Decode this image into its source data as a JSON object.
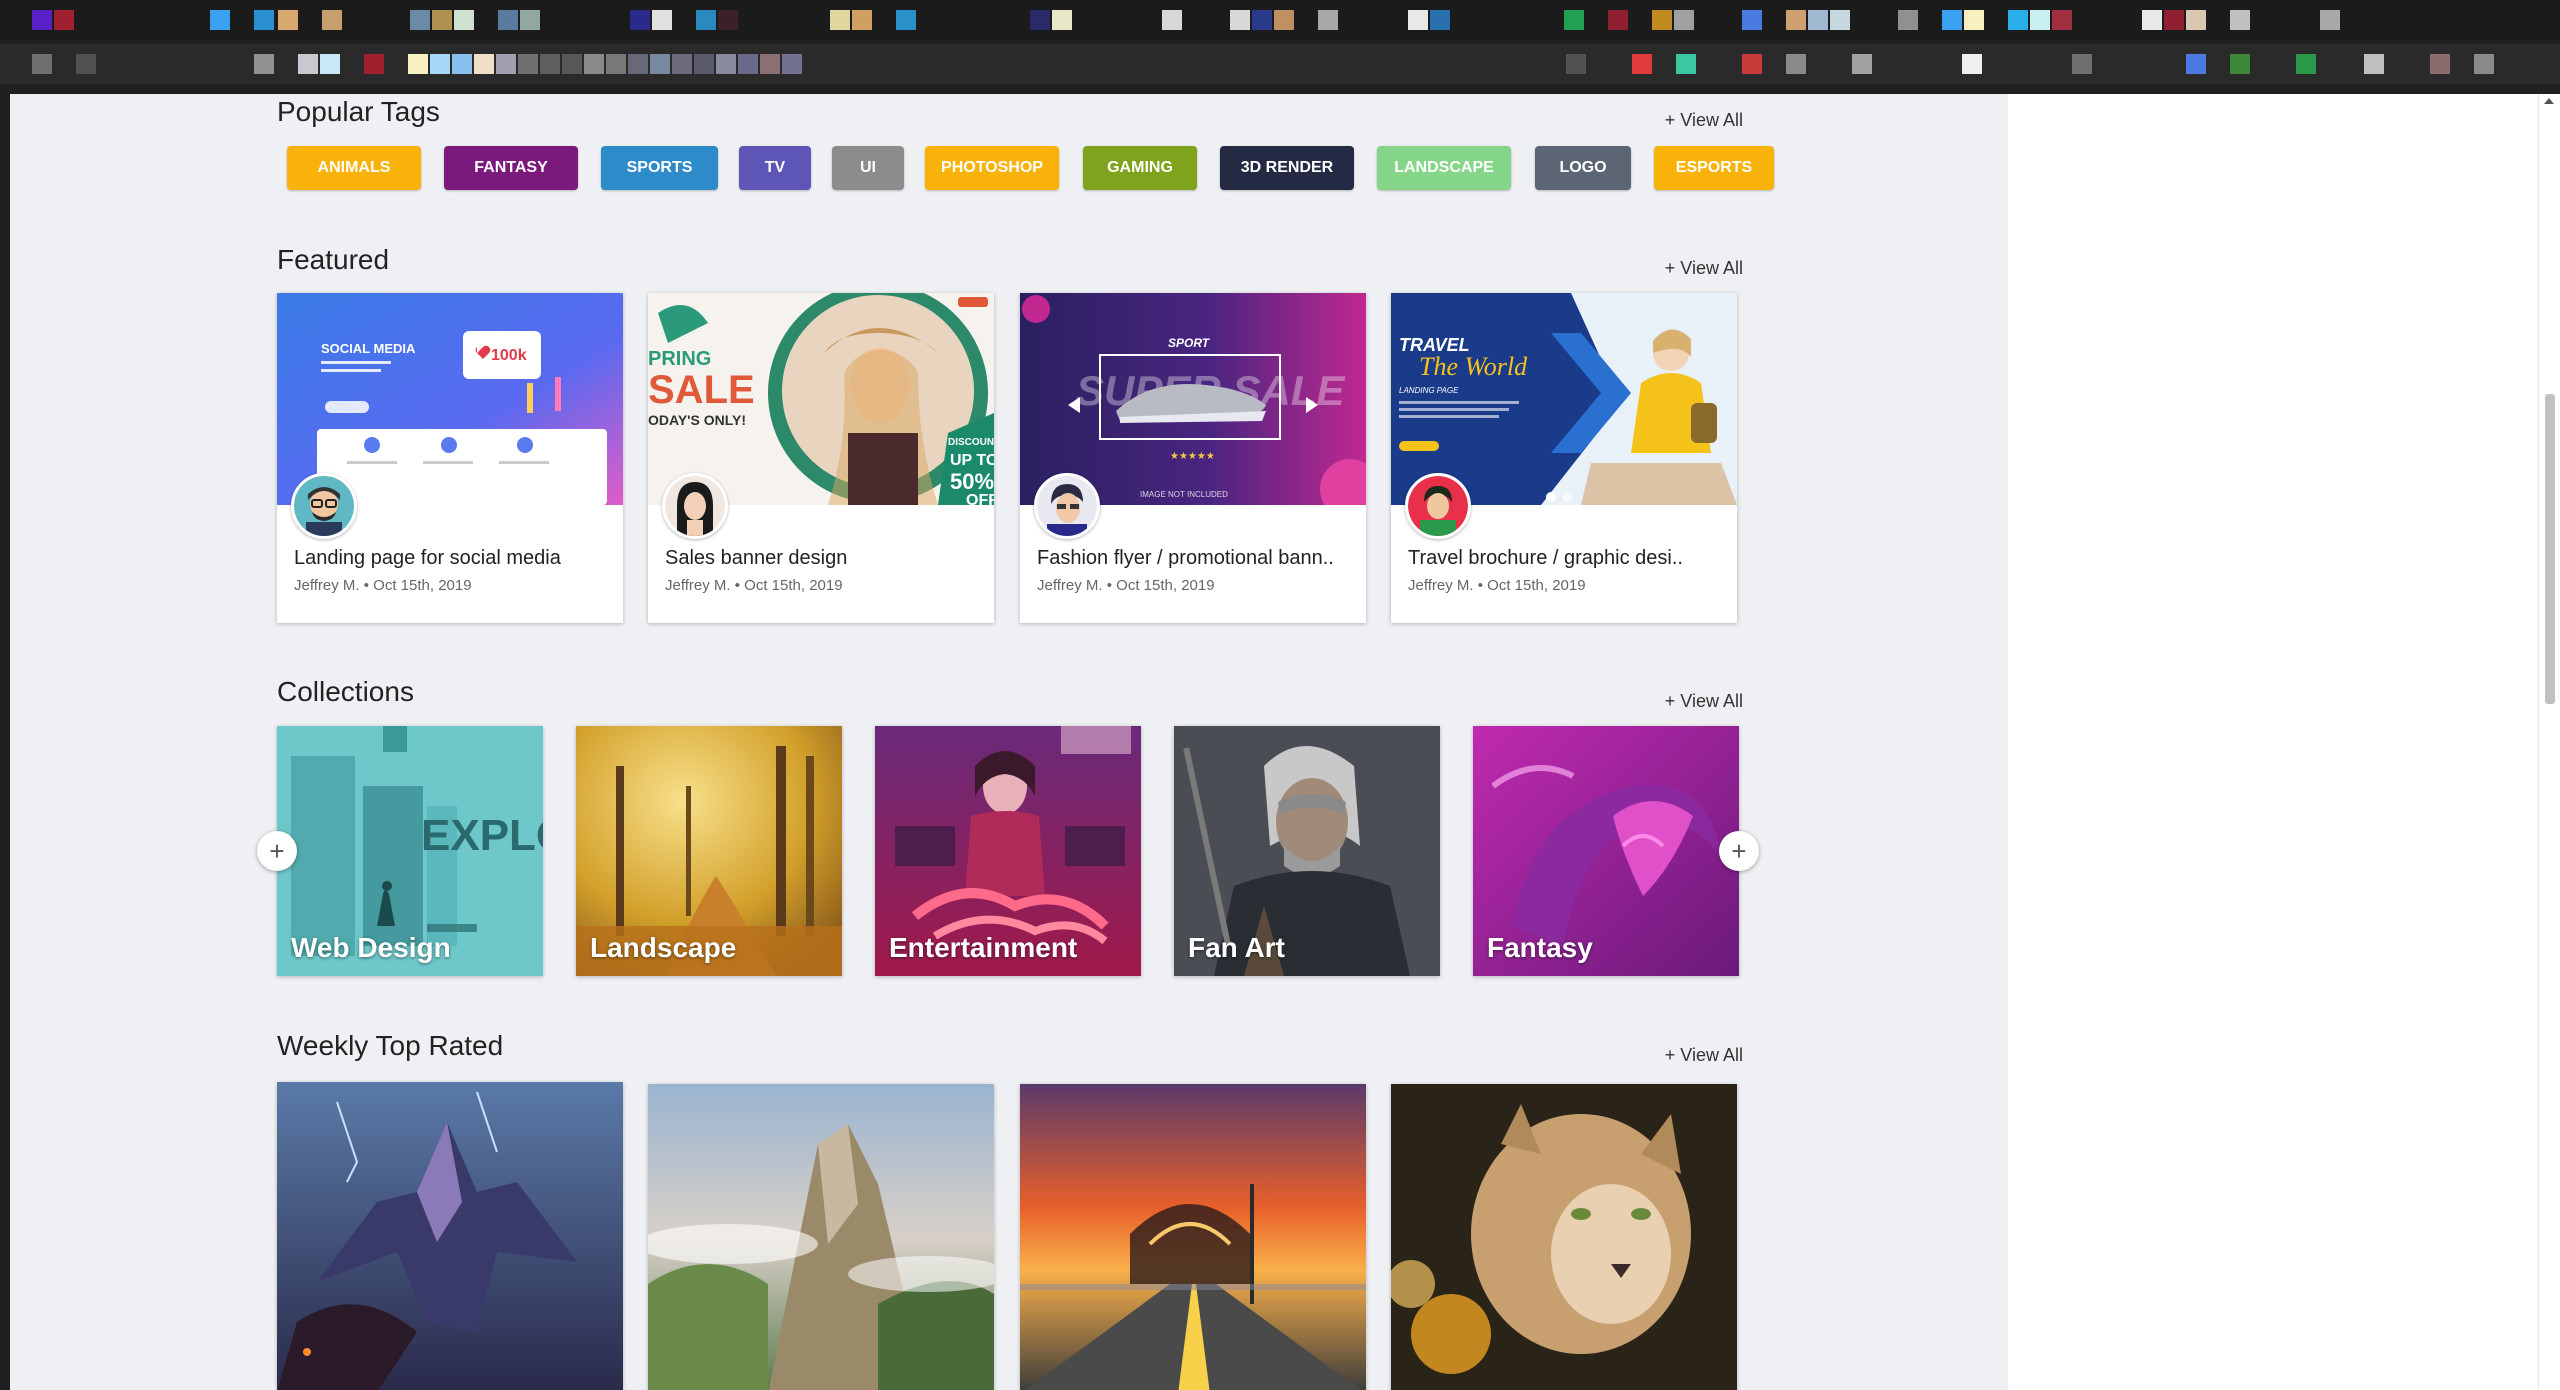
{
  "popular_tags": {
    "title": "Popular Tags",
    "view_all": "View All",
    "tags": [
      {
        "label": "ANIMALS",
        "color": "#F9B209"
      },
      {
        "label": "FANTASY",
        "color": "#7B1A7C"
      },
      {
        "label": "SPORTS",
        "color": "#2E8BC9"
      },
      {
        "label": "TV",
        "color": "#5E56B7"
      },
      {
        "label": "UI",
        "color": "#8C8C8C"
      },
      {
        "label": "PHOTOSHOP",
        "color": "#F9B209"
      },
      {
        "label": "GAMING",
        "color": "#7FA31C"
      },
      {
        "label": "3D RENDER",
        "color": "#252A44"
      },
      {
        "label": "LANDSCAPE",
        "color": "#86D68A"
      },
      {
        "label": "LOGO",
        "color": "#5B6573"
      },
      {
        "label": "ESPORTS",
        "color": "#F9B209"
      }
    ]
  },
  "featured": {
    "title": "Featured",
    "view_all": "View All",
    "cards": [
      {
        "title": "Landing page for social media",
        "author": "Jeffrey M.",
        "date": "Oct 15th, 2019"
      },
      {
        "title": "Sales banner design",
        "author": "Jeffrey M.",
        "date": "Oct 15th, 2019"
      },
      {
        "title": "Fashion flyer / promotional bann..",
        "author": "Jeffrey M.",
        "date": "Oct 15th, 2019"
      },
      {
        "title": "Travel brochure / graphic desi..",
        "author": "Jeffrey M.",
        "date": "Oct 15th, 2019"
      }
    ],
    "thumb_texts": {
      "social": "SOCIAL MEDIA",
      "likes": "100k",
      "spring": "PRING",
      "sale": "SALE",
      "today": "ODAY'S ONLY!",
      "discount": "DISCOUNT",
      "upto": "UP TO",
      "pct": "50%",
      "off": "OFF",
      "sport": "SPORT",
      "supersale": "SUPER SALE",
      "notincluded": "IMAGE NOT INCLUDED",
      "travel": "TRAVEL",
      "world": "The World",
      "landing": "LANDING PAGE"
    }
  },
  "collections": {
    "title": "Collections",
    "view_all": "View All",
    "items": [
      {
        "label": "Web Design"
      },
      {
        "label": "Landscape"
      },
      {
        "label": "Entertainment"
      },
      {
        "label": "Fan Art"
      },
      {
        "label": "Fantasy"
      }
    ],
    "explore_text": "EXPLO"
  },
  "weekly_top_rated": {
    "title": "Weekly Top Rated",
    "view_all": "View All"
  }
}
